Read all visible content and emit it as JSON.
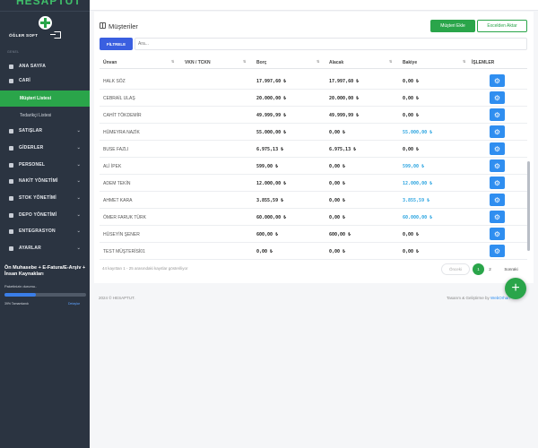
{
  "app": {
    "logo": "HESAPTUT"
  },
  "sidebar": {
    "user": "ÖĞLER SOFT",
    "menu_head": "GENEL",
    "items": [
      {
        "label": "ANA SAYFA",
        "icon": "home-icon"
      },
      {
        "label": "CARİ",
        "icon": "user-icon"
      },
      {
        "label": "SATIŞLAR",
        "icon": "cart-icon"
      },
      {
        "label": "GİDERLER",
        "icon": "expense-icon"
      },
      {
        "label": "PERSONEL",
        "icon": "people-icon"
      },
      {
        "label": "NAKİT YÖNETİMİ",
        "icon": "cash-icon"
      },
      {
        "label": "STOK YÖNETİMİ",
        "icon": "box-icon"
      },
      {
        "label": "DEPO YÖNETİMİ",
        "icon": "warehouse-icon"
      },
      {
        "label": "ENTEGRASYON",
        "icon": "plug-icon"
      },
      {
        "label": "AYARLAR",
        "icon": "gear-icon"
      }
    ],
    "sub_items": [
      "Müşteri Listesi",
      "Tedarikçi Listesi"
    ],
    "promo": {
      "title": "Ön Muhasebe + E-Fatura/E-Arşiv + İnsan Kaynakları",
      "subtitle": "Paketinizin durumu..",
      "progress_pct": 39,
      "progress_text": "39% Tamamlandı",
      "link": "Detaylar"
    }
  },
  "main": {
    "title": "Müşteriler",
    "add_button": "Müşteri Ekle",
    "excel_button": "Excelden Aktar",
    "filter_button": "FİLTRELE",
    "search_placeholder": "Ara...",
    "columns": [
      "Ünvan",
      "VKN / TCKN",
      "Borç",
      "Alacak",
      "Bakiye",
      "İŞLEMLER"
    ],
    "rows": [
      {
        "name": "HALK SÖZ",
        "vkn": "",
        "borc": "17.997,60 ₺",
        "alacak": "17.997,60 ₺",
        "bakiye": "0,00 ₺",
        "positive": false
      },
      {
        "name": "CEBRAİL ULAŞ",
        "vkn": "",
        "borc": "20.000,00 ₺",
        "alacak": "20.000,00 ₺",
        "bakiye": "0,00 ₺",
        "positive": false
      },
      {
        "name": "CAHİT TÖKDEMİR",
        "vkn": "",
        "borc": "49.999,99 ₺",
        "alacak": "49.999,99 ₺",
        "bakiye": "0,00 ₺",
        "positive": false
      },
      {
        "name": "HÜMEYRA NAZİK",
        "vkn": "",
        "borc": "55.000,00 ₺",
        "alacak": "0,00 ₺",
        "bakiye": "55.000,00 ₺",
        "positive": true
      },
      {
        "name": "BUSE FAZLI",
        "vkn": "",
        "borc": "6.975,13 ₺",
        "alacak": "6.975,13 ₺",
        "bakiye": "0,00 ₺",
        "positive": false
      },
      {
        "name": "ALİ İPEK",
        "vkn": "",
        "borc": "599,00 ₺",
        "alacak": "0,00 ₺",
        "bakiye": "599,00 ₺",
        "positive": true
      },
      {
        "name": "ADEM TEKİN",
        "vkn": "",
        "borc": "12.000,00 ₺",
        "alacak": "0,00 ₺",
        "bakiye": "12.000,00 ₺",
        "positive": true
      },
      {
        "name": "AHMET KARA",
        "vkn": "",
        "borc": "3.855,59 ₺",
        "alacak": "0,00 ₺",
        "bakiye": "3.855,59 ₺",
        "positive": true
      },
      {
        "name": "ÖMER FARUK TÜRK",
        "vkn": "",
        "borc": "60.000,00 ₺",
        "alacak": "0,00 ₺",
        "bakiye": "60.000,00 ₺",
        "positive": true
      },
      {
        "name": "HÜSEYİN ŞENER",
        "vkn": "",
        "borc": "600,00 ₺",
        "alacak": "600,00 ₺",
        "bakiye": "0,00 ₺",
        "positive": false
      },
      {
        "name": "TEST MÜŞTERİSİ01",
        "vkn": "",
        "borc": "0,00 ₺",
        "alacak": "0,00 ₺",
        "bakiye": "0,00 ₺",
        "positive": false
      }
    ],
    "footer_info": "44 kayıttan 1 - 25 arasındaki kayıtlar gösteriliyor",
    "pager": {
      "prev": "Önceki",
      "pages": [
        "1",
        "2"
      ],
      "next": "Sonraki"
    },
    "copyright": "2024 © HESAPTUT.",
    "credit_prefix": "Tasarım & Geliştirme by",
    "credit_name": "WebOrhan"
  },
  "colors": {
    "brand_green": "#2aa54a",
    "sidebar_bg": "#2b3441",
    "action_blue": "#2f8ef0",
    "filter_blue": "#3a5fe0",
    "balance_blue": "#29a3e0"
  }
}
